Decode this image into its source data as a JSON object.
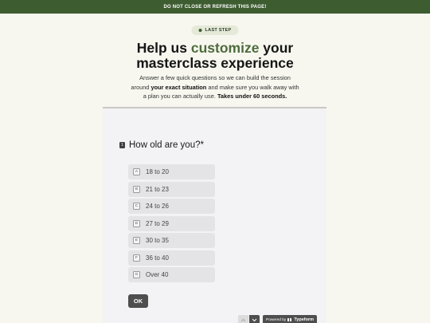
{
  "banner": {
    "text": "DO NOT CLOSE OR REFRESH THIS PAGE!"
  },
  "badge": {
    "label": "LAST STEP"
  },
  "headline": {
    "part1": "Help us ",
    "accent": "customize",
    "part2": " your",
    "line2": "masterclass experience"
  },
  "subtext": {
    "line1": "Answer a few quick questions so we can build the session",
    "line2_pre": "around ",
    "line2_bold": "your exact situation",
    "line2_post": " and make sure you walk away with",
    "line3_pre": "a plan you can actually use. ",
    "line3_bold": "Takes under 60 seconds."
  },
  "form": {
    "question_number": "1",
    "question_text": "How old are you?*",
    "options": [
      {
        "key": "A",
        "label": "18 to 20"
      },
      {
        "key": "B",
        "label": "21 to 23"
      },
      {
        "key": "C",
        "label": "24 to 26"
      },
      {
        "key": "D",
        "label": "27 to 29"
      },
      {
        "key": "E",
        "label": "30 to 35"
      },
      {
        "key": "F",
        "label": "36 to 40"
      },
      {
        "key": "G",
        "label": "Over 40"
      }
    ],
    "ok_label": "OK",
    "powered_prefix": "Powered by",
    "powered_brand": "Typeform"
  },
  "colors": {
    "brand_green": "#3d5c30",
    "accent_green": "#4d6b3c",
    "page_background": "#f7f7ef",
    "form_background": "#f3f2f4",
    "button_dark": "#4e4e4e"
  },
  "icons": {
    "badge_dot": "dot-icon",
    "nav_up": "chevron-up-icon",
    "nav_down": "chevron-down-icon",
    "typeform_logo": "typeform-logo-icon"
  }
}
